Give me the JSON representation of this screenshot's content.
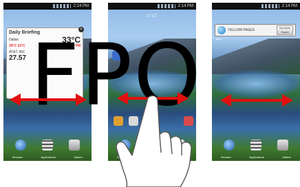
{
  "watermark": "FPO",
  "status_time": "2:14 PM",
  "panels": [
    {
      "widget": {
        "title": "Daily Briefing",
        "city": "Dallas",
        "hi_lo": "39°C 23°C",
        "temp": "33°C",
        "quote_small": "5:31 PM",
        "stock_value": "27.57",
        "stock_label": "AT&T, INC"
      },
      "dock": [
        "Browser",
        "Applications",
        "Market"
      ]
    },
    {
      "carrier": "AT&T",
      "dock": [
        "Browser",
        "Applications",
        "Market"
      ]
    },
    {
      "search": {
        "brand": "at&t",
        "query": "YELLOW PAGES",
        "button": "Biz Name Search"
      },
      "dock": [
        "Browser",
        "Applications",
        "Market"
      ]
    }
  ],
  "colors": {
    "arrow": "#e01010",
    "hand": "#ffffff"
  },
  "icons": [
    "globe-icon",
    "grid-icon",
    "market-icon",
    "hand-icon",
    "arrow-icon"
  ]
}
